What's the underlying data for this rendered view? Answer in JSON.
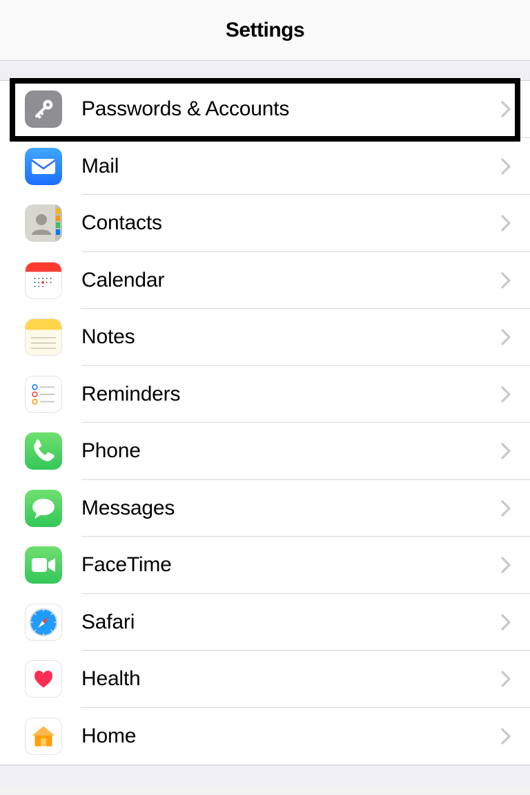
{
  "header": {
    "title": "Settings"
  },
  "rows": [
    {
      "id": "passwords-accounts",
      "label": "Passwords & Accounts",
      "icon": "key-icon"
    },
    {
      "id": "mail",
      "label": "Mail",
      "icon": "mail-icon"
    },
    {
      "id": "contacts",
      "label": "Contacts",
      "icon": "contacts-icon"
    },
    {
      "id": "calendar",
      "label": "Calendar",
      "icon": "calendar-icon"
    },
    {
      "id": "notes",
      "label": "Notes",
      "icon": "notes-icon"
    },
    {
      "id": "reminders",
      "label": "Reminders",
      "icon": "reminders-icon"
    },
    {
      "id": "phone",
      "label": "Phone",
      "icon": "phone-icon"
    },
    {
      "id": "messages",
      "label": "Messages",
      "icon": "messages-icon"
    },
    {
      "id": "facetime",
      "label": "FaceTime",
      "icon": "facetime-icon"
    },
    {
      "id": "safari",
      "label": "Safari",
      "icon": "safari-icon"
    },
    {
      "id": "health",
      "label": "Health",
      "icon": "health-icon"
    },
    {
      "id": "home",
      "label": "Home",
      "icon": "home-icon"
    }
  ],
  "highlight_row": "passwords-accounts"
}
